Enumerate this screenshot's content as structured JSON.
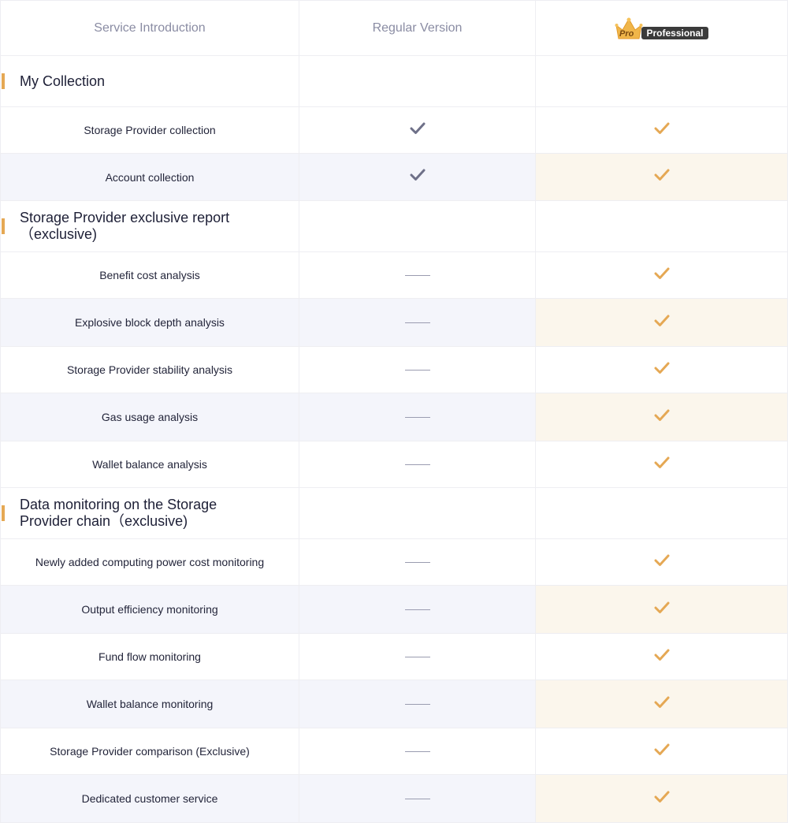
{
  "header": {
    "col1": "Service Introduction",
    "col2": "Regular Version",
    "col3_badge": "Pro",
    "col3": "Professional"
  },
  "colors": {
    "accent": "#e5a854",
    "regular_check": "#6e7088",
    "pro_check": "#e5a854",
    "alt_row": "#f4f5fb",
    "alt_row_pro": "#fbf6ec"
  },
  "rows": [
    {
      "type": "section",
      "label": "My Collection",
      "height": 65
    },
    {
      "type": "item",
      "label": "Storage Provider collection",
      "regular": "check",
      "pro": "check",
      "alt": false,
      "height": 59
    },
    {
      "type": "item",
      "label": "Account collection",
      "regular": "check",
      "pro": "check",
      "alt": true,
      "height": 60
    },
    {
      "type": "section",
      "label": "Storage Provider exclusive report（exclusive)",
      "height": 65
    },
    {
      "type": "item",
      "label": "Benefit cost analysis",
      "regular": "dash",
      "pro": "check",
      "alt": false,
      "height": 59
    },
    {
      "type": "item",
      "label": "Explosive block depth analysis",
      "regular": "dash",
      "pro": "check",
      "alt": true,
      "height": 61
    },
    {
      "type": "item",
      "label": "Storage Provider stability analysis",
      "regular": "dash",
      "pro": "check",
      "alt": false,
      "height": 59
    },
    {
      "type": "item",
      "label": "Gas usage analysis",
      "regular": "dash",
      "pro": "check",
      "alt": true,
      "height": 61
    },
    {
      "type": "item",
      "label": "Wallet balance analysis",
      "regular": "dash",
      "pro": "check",
      "alt": false,
      "height": 59
    },
    {
      "type": "section",
      "label": "Data monitoring on the Storage Provider chain（exclusive)",
      "height": 65
    },
    {
      "type": "item",
      "label": "Newly added computing power cost monitoring",
      "regular": "dash",
      "pro": "check",
      "alt": false,
      "height": 59
    },
    {
      "type": "item",
      "label": "Output efficiency monitoring",
      "regular": "dash",
      "pro": "check",
      "alt": true,
      "height": 61
    },
    {
      "type": "item",
      "label": "Fund flow monitoring",
      "regular": "dash",
      "pro": "check",
      "alt": false,
      "height": 59
    },
    {
      "type": "item",
      "label": "Wallet balance monitoring",
      "regular": "dash",
      "pro": "check",
      "alt": true,
      "height": 61
    },
    {
      "type": "item",
      "label": "Storage Provider comparison (Exclusive)",
      "regular": "dash",
      "pro": "check",
      "alt": false,
      "height": 59
    },
    {
      "type": "item",
      "label": "Dedicated customer service",
      "regular": "dash",
      "pro": "check",
      "alt": true,
      "height": 61
    }
  ]
}
